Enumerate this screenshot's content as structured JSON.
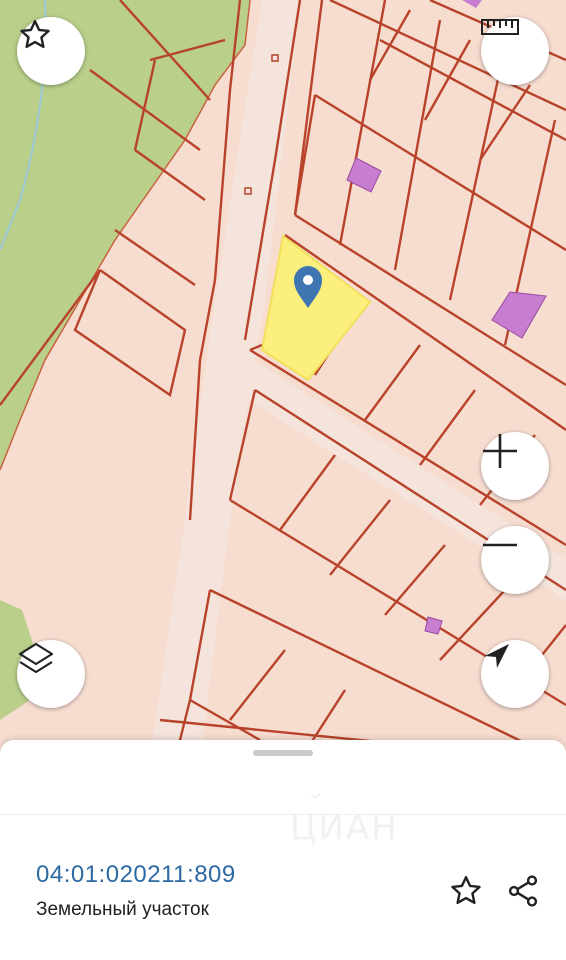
{
  "map": {
    "colors": {
      "background": "#f7dcd0",
      "forest": "#b9cf8a",
      "road": "#f3e2d9",
      "parcel_border": "#b8432a",
      "selected_parcel": "#fbef7e",
      "building": "#c77ed0",
      "marker": "#3f76b1"
    }
  },
  "controls": {
    "favorite_icon": "star-outline-icon",
    "ruler_icon": "ruler-icon",
    "zoom_in_icon": "plus-icon",
    "zoom_out_icon": "minus-icon",
    "layers_icon": "layers-icon",
    "locate_icon": "navigation-arrow-icon"
  },
  "sheet": {
    "watermark": "ЦИАН",
    "cadastral_number": "04:01:020211:809",
    "object_type": "Земельный участок",
    "favorite_icon": "star-outline-icon",
    "share_icon": "share-icon"
  }
}
